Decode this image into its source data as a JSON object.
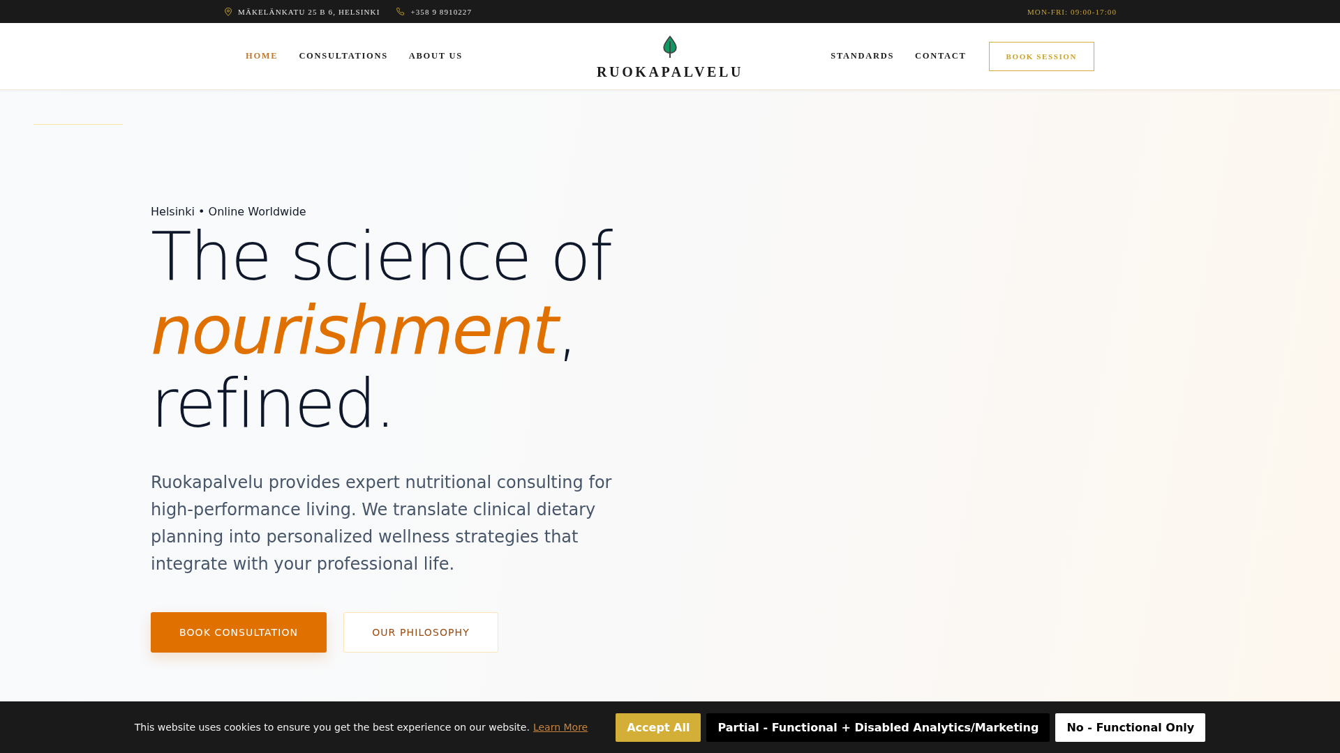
{
  "top_bar": {
    "address": "MÄKELÄNKATU 25 B 6, HELSINKI",
    "phone": "+358 9 8910227",
    "hours": "MON-FRI: 09:00-17:00"
  },
  "nav": {
    "left_links": [
      {
        "label": "HOME",
        "selected": true
      },
      {
        "label": "CONSULTATIONS",
        "selected": false
      },
      {
        "label": "ABOUT US",
        "selected": false
      }
    ],
    "logo": "RUOKAPALVELU",
    "right_links": [
      {
        "label": "STANDARDS",
        "selected": false
      },
      {
        "label": "CONTACT",
        "selected": false
      }
    ],
    "cta": "BOOK SESSION"
  },
  "hero": {
    "eyebrow": "Helsinki • Online Worldwide",
    "headline": "The science of *nourishment*, refined.",
    "description": "Ruokapalvelu provides expert nutritional consulting for high-performance living. We translate clinical dietary planning into personalized wellness strategies that integrate with your professional life.",
    "buttons": [
      {
        "label": "BOOK CONSULTATION",
        "kind": "primary"
      },
      {
        "label": "OUR PHILOSOPHY",
        "kind": "secondary"
      }
    ]
  },
  "cookie_banner": {
    "message": "This website uses cookies to ensure you get the best experience on our website.",
    "link": "Learn More",
    "buttons": [
      {
        "label": "Accept All",
        "kind": "accept"
      },
      {
        "label": "Partial - Functional + Disabled Analytics/Marketing",
        "kind": "partial"
      },
      {
        "label": "No - Functional Only",
        "kind": "reject"
      }
    ]
  }
}
